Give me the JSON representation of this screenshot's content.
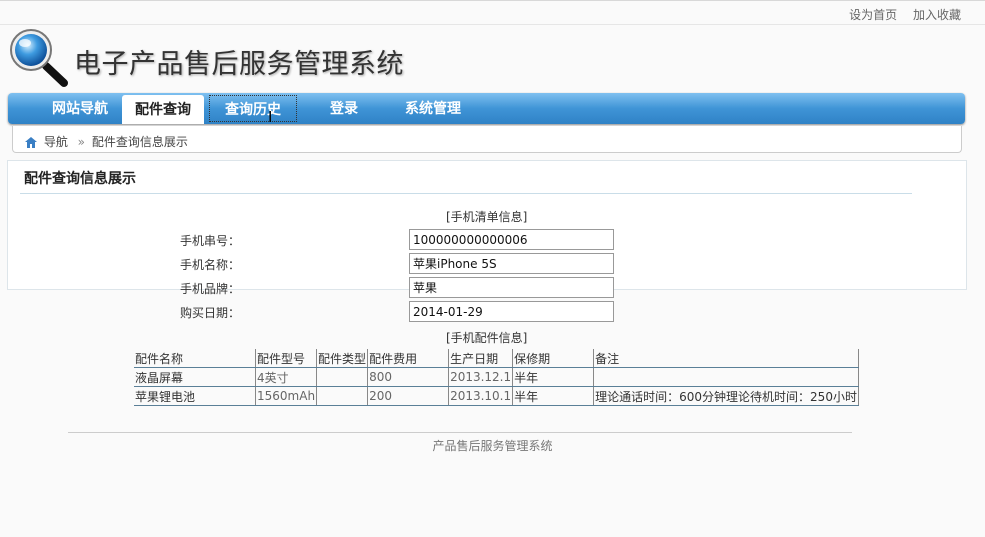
{
  "top_links": {
    "set_home": "设为首页",
    "add_favorite": "加入收藏"
  },
  "site_title": "电子产品售后服务管理系统",
  "nav": {
    "items": [
      "网站导航",
      "配件查询",
      "查询历史",
      "登录",
      "系统管理"
    ],
    "active_index": 1
  },
  "breadcrumb": {
    "home": "导航",
    "sep": "»",
    "current": "配件查询信息展示"
  },
  "panel": {
    "title": "配件查询信息展示"
  },
  "phone_info": {
    "section_title": "[手机清单信息]",
    "fields": [
      {
        "label": "手机串号：",
        "value": "100000000000006"
      },
      {
        "label": "手机名称：",
        "value": "苹果iPhone 5S"
      },
      {
        "label": "手机品牌：",
        "value": "苹果"
      },
      {
        "label": "购买日期：",
        "value": "2014-01-29"
      }
    ]
  },
  "parts_info": {
    "section_title": "[手机配件信息]",
    "columns": [
      "配件名称",
      "配件型号",
      "配件类型",
      "配件费用",
      "生产日期",
      "保修期",
      "备注"
    ],
    "rows": [
      [
        "液晶屏幕",
        "4英寸",
        "",
        "800",
        "2013.12.1",
        "半年",
        ""
      ],
      [
        "苹果锂电池",
        "1560mAh",
        "",
        "200",
        "2013.10.1",
        "半年",
        "理论通话时间：600分钟理论待机时间：250小时"
      ]
    ]
  },
  "footer": "产品售后服务管理系统",
  "colors": {
    "nav_top": "#7fc0f0",
    "nav_bottom": "#2f82c6",
    "table_border": "#5a7f97"
  }
}
